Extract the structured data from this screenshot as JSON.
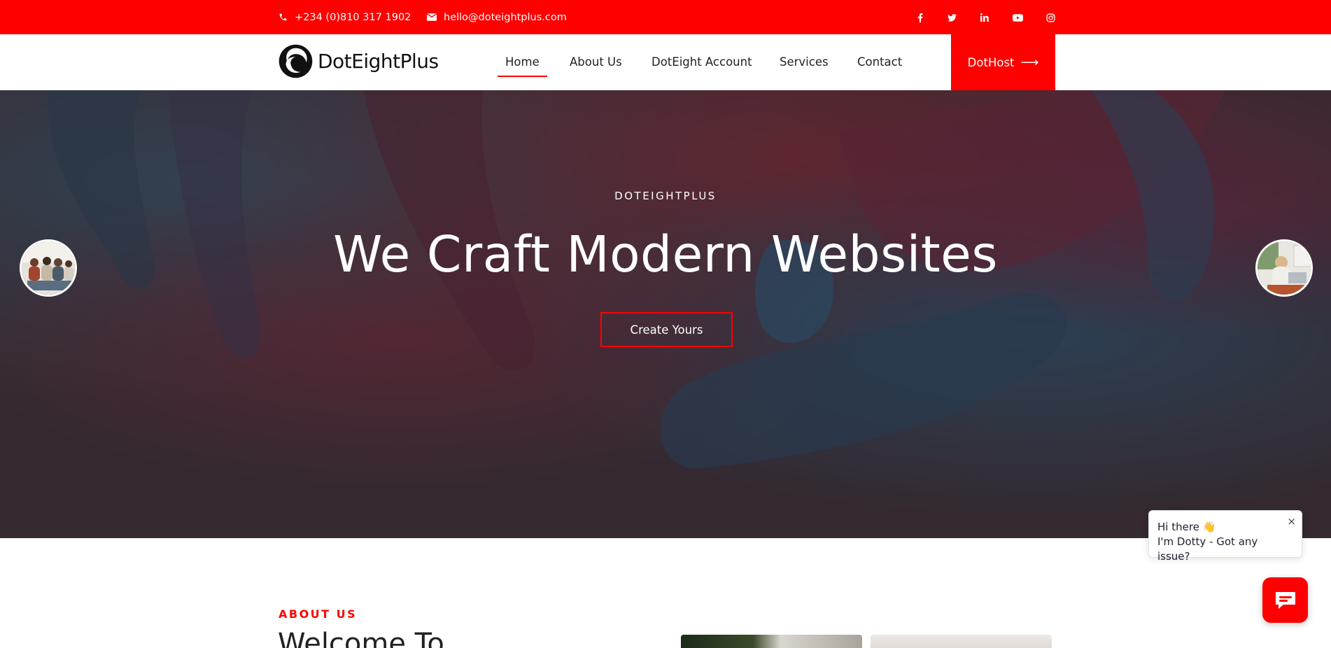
{
  "topbar": {
    "phone": "+234 (0)810 317 1902",
    "email": "hello@doteightplus.com",
    "socials": [
      "facebook-icon",
      "twitter-icon",
      "linkedin-icon",
      "youtube-icon",
      "instagram-icon"
    ]
  },
  "header": {
    "logo_text": "DotEightPlus",
    "nav": [
      {
        "label": "Home",
        "active": true
      },
      {
        "label": "About Us"
      },
      {
        "label": "DotEight Account"
      },
      {
        "label": "Services"
      },
      {
        "label": "Contact"
      }
    ],
    "cta_label": "DotHost",
    "cta_icon": "arrow-right-icon"
  },
  "hero": {
    "eyebrow": "DOTEIGHTPLUS",
    "title": "We Craft Modern Websites",
    "button": "Create Yours"
  },
  "about": {
    "eyebrow": "ABOUT US",
    "title": "Welcome To"
  },
  "chat": {
    "greeting": "Hi there 👋",
    "message": "I'm Dotty - Got any issue?",
    "close": "×",
    "launcher_icon": "chat-icon"
  },
  "colors": {
    "brand": "#ff0000",
    "text": "#222222",
    "white": "#ffffff"
  }
}
